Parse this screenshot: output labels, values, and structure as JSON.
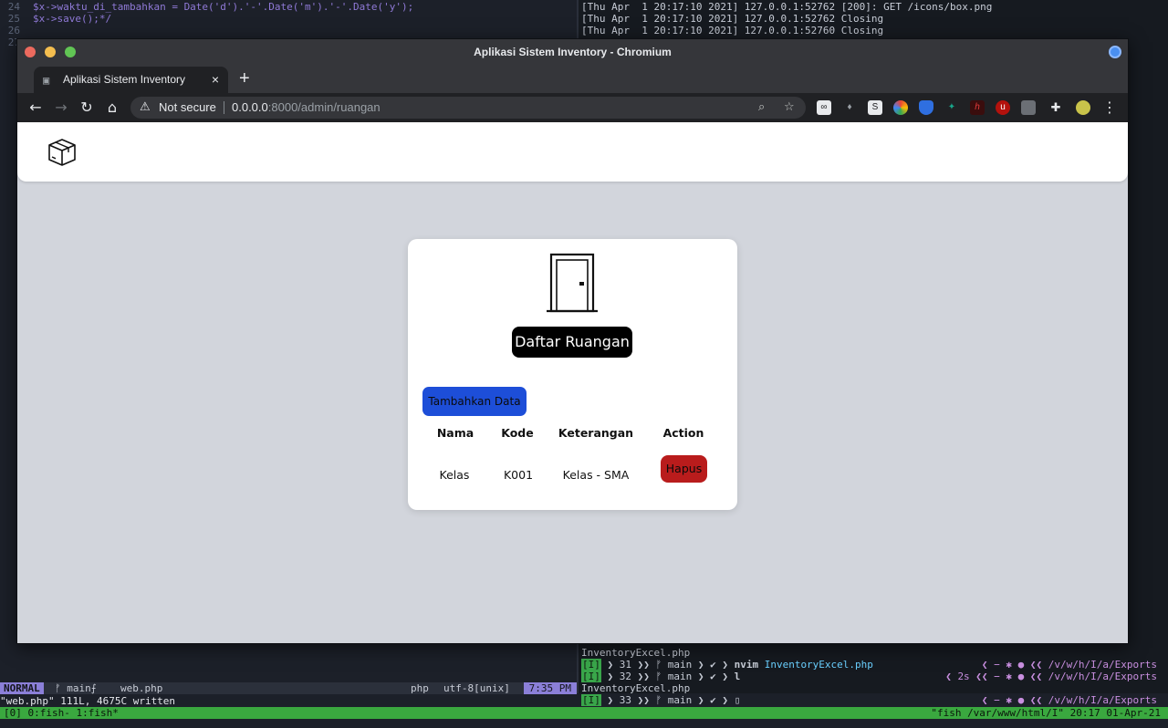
{
  "terminal": {
    "code_top": [
      {
        "n": "24",
        "text": "$x->waktu_di_tambahkan = Date('d').'-'.Date('m').'-'.Date('y');"
      },
      {
        "n": "25",
        "text": "$x->save();*/"
      },
      {
        "n": "26",
        "text": ""
      },
      {
        "n": "27",
        "text": ""
      }
    ],
    "log_lines": [
      "[Thu Apr  1 20:17:10 2021] 127.0.0.1:52762 [200]: GET /icons/box.png",
      "[Thu Apr  1 20:17:10 2021] 127.0.0.1:52762 Closing",
      "[Thu Apr  1 20:17:10 2021] 127.0.0.1:52760 Closing"
    ],
    "vim": {
      "mode": "NORMAL",
      "branch": "ᚠ main⨍",
      "file": "web.php",
      "filetype": "php",
      "encoding": "utf-8[unix]",
      "time": "7:35 PM",
      "message": "\"web.php\" 111L, 4675C written"
    },
    "fish": {
      "file1": "InventoryExcel.php",
      "line1_num": "31",
      "line1_cmd": "nvim",
      "line1_arg": "InventoryExcel.php",
      "line2_num": "32",
      "line2_cmd": "l",
      "file2": "InventoryExcel.php",
      "line3_num": "33",
      "branch": "ᚠ main",
      "right_path": "/v/w/h/I/a/Exports",
      "right_dur": "2s"
    },
    "tmux": {
      "left": "[0] 0:fish- 1:fish*",
      "right": "\"fish  /var/www/html/I\" 20:17 01-Apr-21"
    }
  },
  "browser": {
    "window_title": "Aplikasi Sistem Inventory - Chromium",
    "tab_title": "Aplikasi Sistem Inventory",
    "tab_close": "×",
    "new_tab": "+",
    "security_label": "Not secure",
    "url_host": "0.0.0.0",
    "url_path": ":8000/admin/ruangan"
  },
  "page": {
    "title": "Daftar Ruangan",
    "add_button": "Tambahkan Data",
    "table": {
      "headers": [
        "Nama",
        "Kode",
        "Keterangan",
        "Action"
      ],
      "rows": [
        {
          "nama": "Kelas",
          "kode": "K001",
          "keterangan": "Kelas - SMA",
          "action": "Hapus"
        }
      ]
    }
  }
}
